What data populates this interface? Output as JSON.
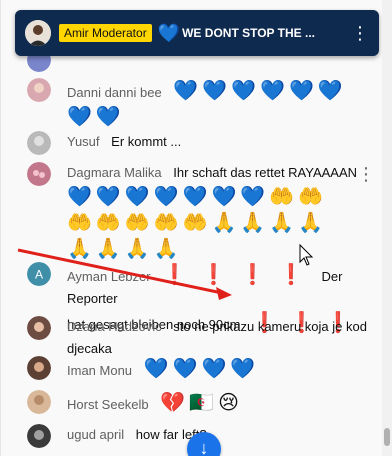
{
  "pinned": {
    "badge": "Amir Moderator",
    "heart": "💙",
    "text": "WE DONT STOP THE ...",
    "menu": "⋮"
  },
  "messages": [
    {
      "name": "Danni danni bee",
      "text": "",
      "emoji_line1": "💙💙💙💙💙💙",
      "emoji_line2": "💙💙"
    },
    {
      "name": "Yusuf",
      "text": "Er kommt ...",
      "emoji_line1": "",
      "emoji_line2": ""
    },
    {
      "name": "Dagmara Malika",
      "text": "Ihr schaft das rettet RAYAAAAN",
      "emoji_line1": "💙💙💙💙💙💙💙🤲🤲",
      "emoji_line2": "🤲🤲🤲🤲🤲🙏🙏🙏🙏",
      "emoji_line3": "🙏🙏🙏🙏"
    },
    {
      "name": "Ayman Lebzer",
      "initial": "A",
      "prefix": "❗❗❗❗",
      "text": "Der Reporter",
      "text2": "hat gesagt bleiben noch 90cm",
      "suffix": "❗❗❗"
    },
    {
      "name": "Dzana Hadzovic",
      "text": "sto ne prikazu kameru koja je kod",
      "text2": "djecaka"
    },
    {
      "name": "Iman Monu",
      "text": "",
      "emoji_line1": "💙💙💙💙"
    },
    {
      "name": "Horst Seekelb",
      "text": "",
      "emoji_line1": "💔🇩🇿😢"
    },
    {
      "name": "ugud april",
      "text": "how far left?"
    }
  ],
  "controls": {
    "scroll_down_icon": "↓",
    "menu_icon": "⋮"
  },
  "colors": {
    "pinned_bg": "#0f2a4f",
    "moderator_badge": "#ffd600",
    "arrow": "#e0201a",
    "accent": "#1a73e8"
  }
}
